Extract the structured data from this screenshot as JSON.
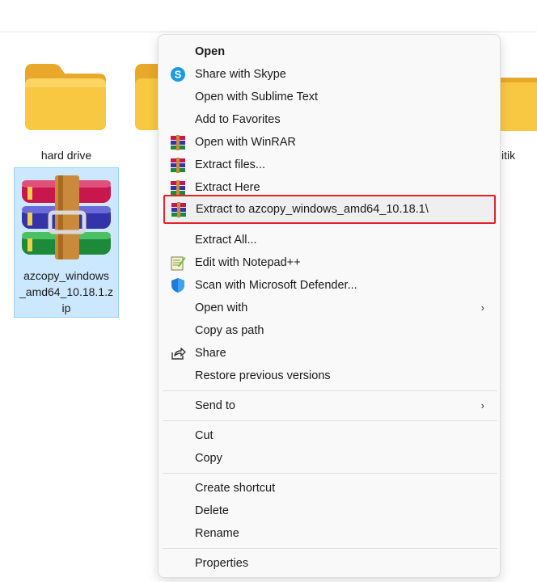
{
  "desktop": {
    "items": [
      {
        "label": "hard drive"
      },
      {
        "label": "azcopy_windows_amd64_10.18.1.zip",
        "lines": [
          "azcopy_windows",
          "_amd64_10.18.1.z",
          "ip"
        ]
      },
      {
        "label_partial": "itik"
      }
    ]
  },
  "menu": {
    "items": [
      {
        "label": "Open",
        "icon": "none",
        "bold": true
      },
      {
        "label": "Share with Skype",
        "icon": "skype-icon"
      },
      {
        "label": "Open with Sublime Text",
        "icon": "none"
      },
      {
        "label": "Add to Favorites",
        "icon": "none"
      },
      {
        "label": "Open with WinRAR",
        "icon": "winrar-icon"
      },
      {
        "label": "Extract files...",
        "icon": "winrar-icon"
      },
      {
        "label": "Extract Here",
        "icon": "winrar-icon"
      },
      {
        "label": "Extract to azcopy_windows_amd64_10.18.1\\",
        "icon": "winrar-icon",
        "highlighted": true
      },
      {
        "label": "Extract All...",
        "icon": "none"
      },
      {
        "label": "Edit with Notepad++",
        "icon": "notepadpp-icon"
      },
      {
        "label": "Scan with Microsoft Defender...",
        "icon": "defender-shield-icon"
      },
      {
        "label": "Open with",
        "icon": "none",
        "submenu": true
      },
      {
        "label": "Copy as path",
        "icon": "none"
      },
      {
        "label": "Share",
        "icon": "share-icon"
      },
      {
        "label": "Restore previous versions",
        "icon": "none"
      },
      {
        "label": "Send to",
        "icon": "none",
        "submenu": true
      },
      {
        "label": "Cut",
        "icon": "none"
      },
      {
        "label": "Copy",
        "icon": "none"
      },
      {
        "label": "Create shortcut",
        "icon": "none"
      },
      {
        "label": "Delete",
        "icon": "none"
      },
      {
        "label": "Rename",
        "icon": "none"
      },
      {
        "label": "Properties",
        "icon": "none"
      }
    ],
    "submenu_arrow": "›"
  },
  "colors": {
    "selection_bg": "#cce8ff",
    "highlight_border": "#e0242a",
    "folder_yellow": "#f8c843"
  }
}
